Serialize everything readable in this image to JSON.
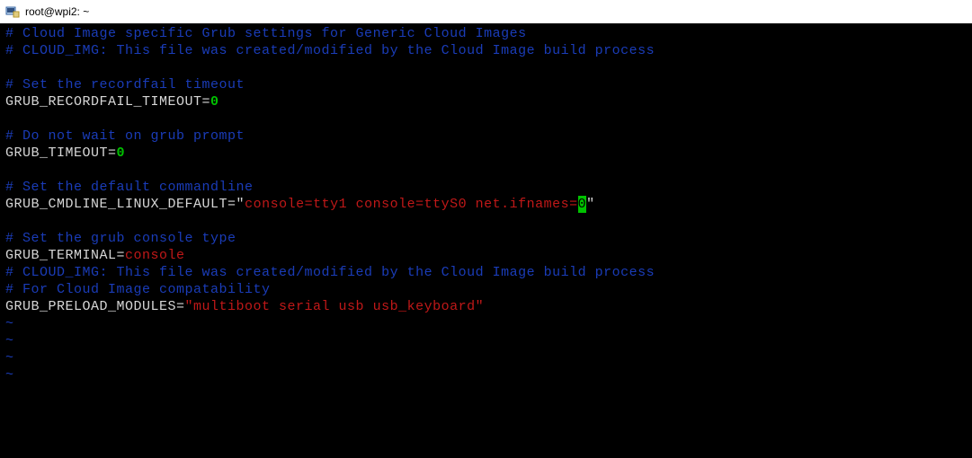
{
  "titlebar": {
    "title": "root@wpi2: ~"
  },
  "lines": {
    "c1": "# Cloud Image specific Grub settings for Generic Cloud Images",
    "c2": "# CLOUD_IMG: This file was created/modified by the Cloud Image build process",
    "c3": "# Set the recordfail timeout",
    "k1": "GRUB_RECORDFAIL_TIMEOUT=",
    "v1": "0",
    "c4": "# Do not wait on grub prompt",
    "k2": "GRUB_TIMEOUT=",
    "v2": "0",
    "c5": "# Set the default commandline",
    "k3": "GRUB_CMDLINE_LINUX_DEFAULT=",
    "q1": "\"",
    "s1": "console=tty1 console=ttyS0 net.ifnames=",
    "cur": "0",
    "q2": "\"",
    "c6": "# Set the grub console type",
    "k4": "GRUB_TERMINAL=",
    "v4": "console",
    "c7": "# CLOUD_IMG: This file was created/modified by the Cloud Image build process",
    "c8": "# For Cloud Image compatability",
    "k5": "GRUB_PRELOAD_MODULES=",
    "s5": "\"multiboot serial usb usb_keyboard\"",
    "tilde": "~"
  }
}
